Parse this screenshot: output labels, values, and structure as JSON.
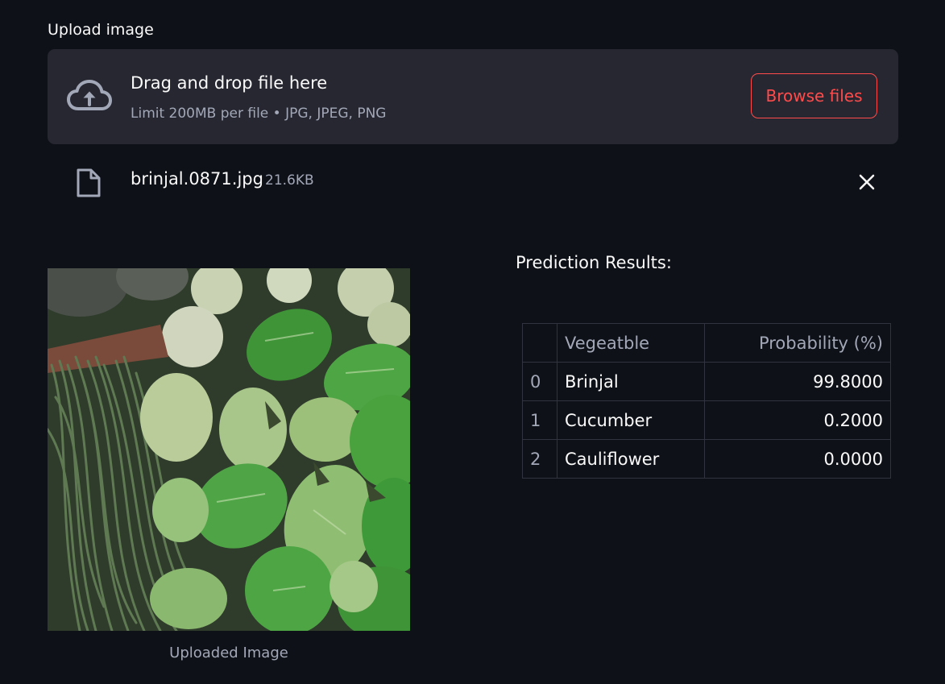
{
  "uploader": {
    "label": "Upload image",
    "dropzone_title": "Drag and drop file here",
    "dropzone_subtitle": "Limit 200MB per file • JPG, JPEG, PNG",
    "browse_label": "Browse files",
    "cloud_icon": "cloud-upload-icon"
  },
  "file": {
    "name": "brinjal.0871.jpg",
    "size": "21.6KB",
    "icon": "file-icon",
    "close_icon": "close-icon"
  },
  "image": {
    "caption": "Uploaded Image"
  },
  "results": {
    "title": "Prediction Results:",
    "columns": [
      "",
      "Vegeatble",
      "Probability (%)"
    ],
    "rows": [
      {
        "index": "0",
        "vegetable": "Brinjal",
        "probability": "99.8000"
      },
      {
        "index": "1",
        "vegetable": "Cucumber",
        "probability": "0.2000"
      },
      {
        "index": "2",
        "vegetable": "Cauliflower",
        "probability": "0.0000"
      }
    ]
  },
  "colors": {
    "background": "#0e1117",
    "dropzone": "#262730",
    "accent": "#ff4b4b",
    "muted_text": "#a3a8b8"
  }
}
